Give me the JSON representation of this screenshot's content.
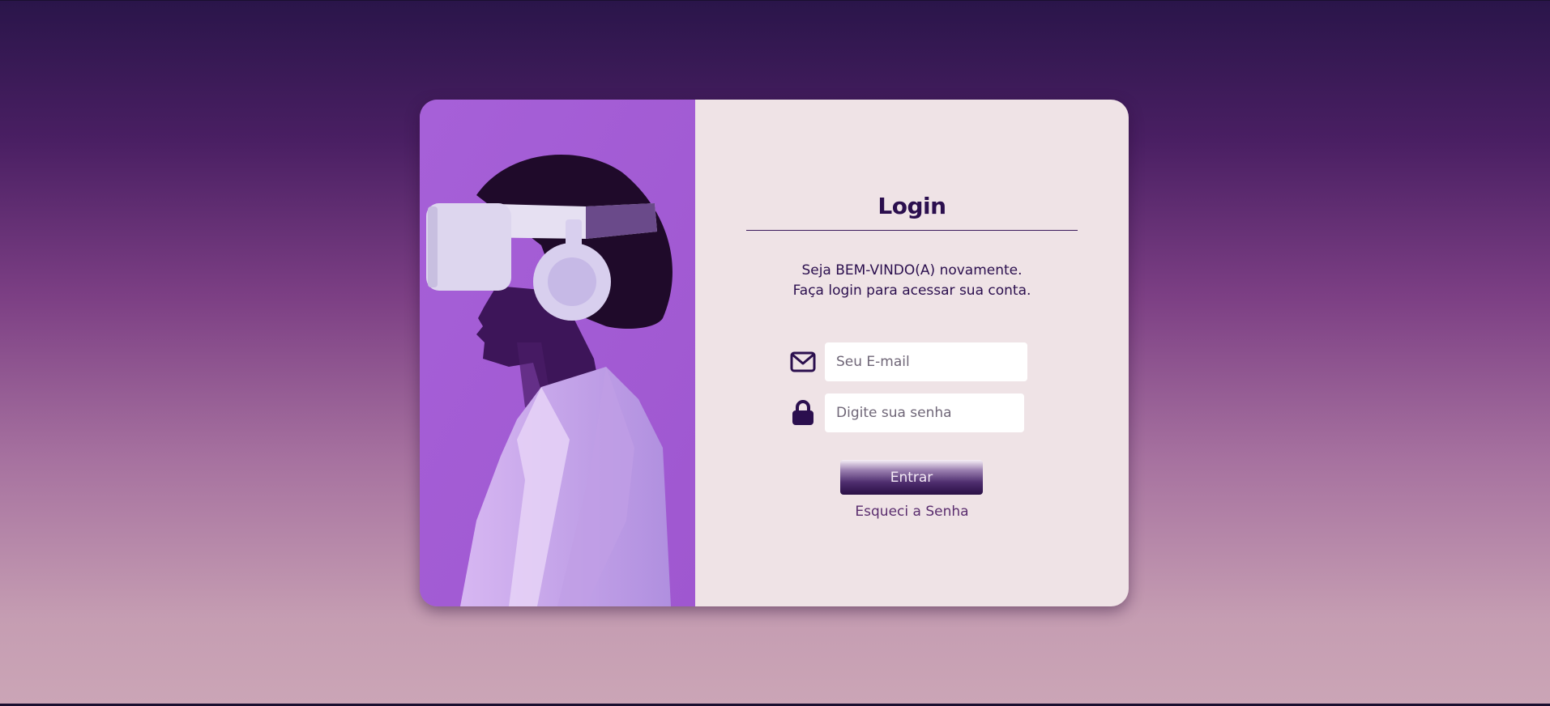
{
  "login": {
    "title": "Login",
    "welcome_line1": "Seja BEM-VINDO(A) novamente.",
    "welcome_line2": "Faça login para acessar sua conta.",
    "email": {
      "icon": "envelope-icon",
      "placeholder": "Seu E-mail",
      "value": ""
    },
    "password": {
      "icon": "lock-icon",
      "placeholder": "Digite sua senha",
      "value": ""
    },
    "submit_label": "Entrar",
    "forgot_label": "Esqueci a Senha"
  },
  "colors": {
    "accent": "#2b0f4e",
    "panel_bg": "#efe3e6",
    "photo_bg": "#a65fd6"
  }
}
